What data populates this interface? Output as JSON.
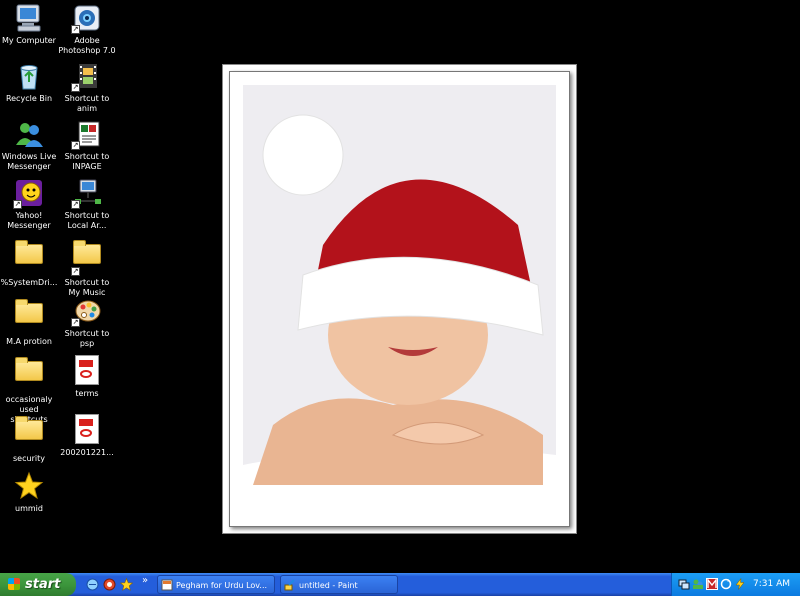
{
  "desktop_icons": [
    {
      "label": "My Computer"
    },
    {
      "label": "Adobe Photoshop 7.0"
    },
    {
      "label": "Recycle Bin"
    },
    {
      "label": "Shortcut to anim"
    },
    {
      "label": "Windows Live Messenger"
    },
    {
      "label": "Shortcut to INPAGE"
    },
    {
      "label": "Yahoo! Messenger"
    },
    {
      "label": "Shortcut to Local Ar..."
    },
    {
      "label": "%SystemDri..."
    },
    {
      "label": "Shortcut to My Music"
    },
    {
      "label": "M.A protion"
    },
    {
      "label": "Shortcut to psp"
    },
    {
      "label": "occasionaly used shortcuts"
    },
    {
      "label": "terms"
    },
    {
      "label": "security"
    },
    {
      "label": "200201221..."
    },
    {
      "label": "ummid"
    }
  ],
  "taskbar": {
    "start_label": "start",
    "tasks": [
      {
        "label": "Pegham for Urdu Lov..."
      },
      {
        "label": "untitled - Paint"
      }
    ],
    "quick_launch_more": "»",
    "clock": "7:31 AM"
  },
  "colors": {
    "desktop_background": "#000000",
    "taskbar_blue": "#245edb",
    "start_green": "#3c963c",
    "tray_blue": "#0c7ae0"
  }
}
